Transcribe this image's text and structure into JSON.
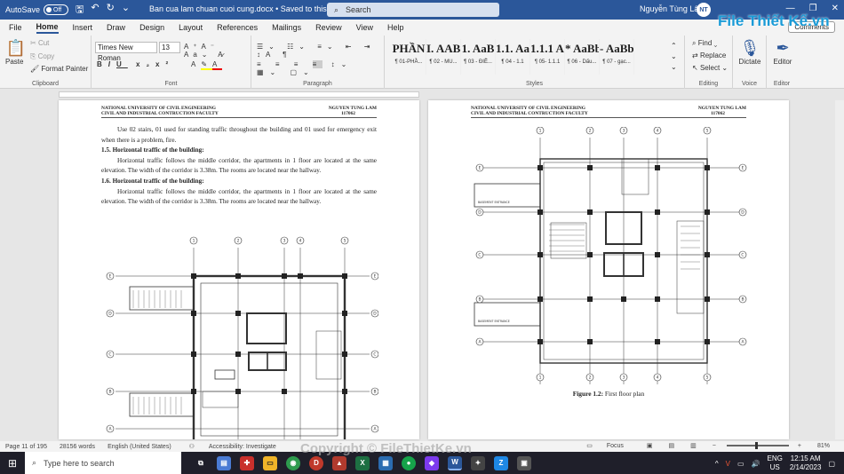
{
  "titlebar": {
    "autosave_label": "AutoSave",
    "autosave_state": "Off",
    "doc_title": "Ban cua lam chuan cuoi cung.docx • Saved to this PC ⌄",
    "search_placeholder": "Search",
    "user_name": "Nguyễn Tùng Lâm",
    "user_initials": "NT"
  },
  "tabs": [
    "File",
    "Home",
    "Insert",
    "Draw",
    "Design",
    "Layout",
    "References",
    "Mailings",
    "Review",
    "View",
    "Help"
  ],
  "active_tab": "Home",
  "comments_label": "Comments",
  "ribbon": {
    "clipboard": {
      "paste": "Paste",
      "cut": "Cut",
      "copy": "Copy",
      "format_painter": "Format Painter",
      "label": "Clipboard"
    },
    "font": {
      "name": "Times New Roman",
      "size": "13",
      "label": "Font"
    },
    "paragraph": {
      "label": "Paragraph"
    },
    "styles": {
      "label": "Styles",
      "items": [
        {
          "big": "PHẦN",
          "small": "¶ 01-PHẦ..."
        },
        {
          "big": "I. AAB",
          "small": "¶ 02 - MU..."
        },
        {
          "big": "1. AaB",
          "small": "¶ 03 - ĐIỀ..."
        },
        {
          "big": "1.1. Aa",
          "small": "¶ 04 - 1.1"
        },
        {
          "big": "1.1.1 A:",
          "small": "¶ 05- 1.1.1"
        },
        {
          "big": "* AaBb",
          "small": "¶ 06 - Dấu..."
        },
        {
          "big": "- AaBb(",
          "small": "¶ 07 - gạc..."
        }
      ]
    },
    "editing": {
      "find": "Find",
      "replace": "Replace",
      "select": "Select",
      "label": "Editing"
    },
    "voice": {
      "dictate": "Dictate",
      "label": "Voice"
    },
    "editor": {
      "editor": "Editor",
      "label": "Editor"
    }
  },
  "page_header": {
    "left_line1": "NATIONAL UNIVERSITY OF CIVIL ENGINEERING",
    "left_line2": "CIVIL AND INDUSTRIAL CONTRUCTION FACULTY",
    "right_line1": "NGUYEN TUNG LAM",
    "right_line2": "117062"
  },
  "page1": {
    "p1": "Use 02 stairs, 01 used for standing traffic throughout the building and 01 used for emergency exit when there is a problem, fire.",
    "h1": "1.5.   Horizontal traffic of the building:",
    "p2": "Horizontal traffic follows the middle corridor, the apartments in 1 floor are located at the same elevation. The width of the corridor is 3.38m. The rooms are located near the hallway.",
    "h2": "1.6.   Horizontal traffic of the building:",
    "p3": "Horizontal traffic follows the middle corridor, the apartments in 1 floor are located at the same elevation. The width of the corridor is 3.38m. The rooms are located near the hallway."
  },
  "page2": {
    "caption_bold": "Figure 1.2:",
    "caption_text": " First floor plan",
    "basement_label": "BASEMENT ENTRANCE"
  },
  "grid_axes": {
    "columns": [
      "1",
      "2",
      "3",
      "4",
      "5"
    ],
    "rows": [
      "E",
      "D",
      "C",
      "B",
      "A"
    ]
  },
  "statusbar": {
    "page": "Page 11 of 195",
    "words": "28156 words",
    "language": "English (United States)",
    "accessibility": "Accessibility: Investigate",
    "focus": "Focus",
    "zoom": "81%"
  },
  "taskbar": {
    "search_placeholder": "Type here to search",
    "lang_line1": "ENG",
    "lang_line2": "US",
    "time": "12:15 AM",
    "date": "2/14/2023"
  },
  "watermark": {
    "top": "File Thiết Kế.vn",
    "bottom": "Copyright © FileThietKe.vn"
  }
}
